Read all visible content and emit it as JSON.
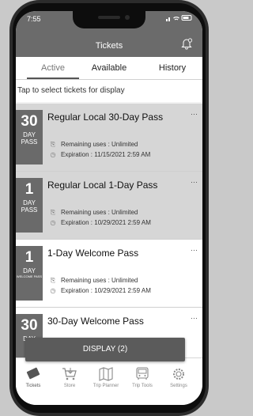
{
  "status": {
    "time": "7:55",
    "icons": "..ll ≈ ▭"
  },
  "header": {
    "title": "Tickets"
  },
  "tabs": [
    {
      "label": "Active"
    },
    {
      "label": "Available"
    },
    {
      "label": "History"
    }
  ],
  "hint": "Tap to select tickets for display",
  "tickets": [
    {
      "num": "30",
      "unit1": "DAY",
      "unit2": "PASS",
      "name": "Regular Local 30-Day Pass",
      "remaining": "Remaining uses : Unlimited",
      "expiration": "Expiration : 11/15/2021 2:59 AM",
      "more": "···"
    },
    {
      "num": "1",
      "unit1": "DAY",
      "unit2": "PASS",
      "name": "Regular Local 1-Day Pass",
      "remaining": "Remaining uses : Unlimited",
      "expiration": "Expiration : 10/29/2021 2:59 AM",
      "more": "···"
    },
    {
      "num": "1",
      "unit1": "DAY",
      "unit2": "WELCOME PASS",
      "name": "1-Day Welcome Pass",
      "remaining": "Remaining uses : Unlimited",
      "expiration": "Expiration : 10/29/2021 2:59 AM",
      "more": "···"
    },
    {
      "num": "30",
      "unit1": "DAY",
      "unit2": "",
      "name": "30-Day Welcome Pass",
      "more": "···"
    }
  ],
  "display_button": "DISPLAY (2)",
  "tabbar": [
    {
      "label": "Tickets",
      "icon": "ticket-icon"
    },
    {
      "label": "Store",
      "icon": "cart-icon"
    },
    {
      "label": "Trip Planner",
      "icon": "map-icon"
    },
    {
      "label": "Trip Tools",
      "icon": "bus-icon"
    },
    {
      "label": "Settings",
      "icon": "gear-icon"
    }
  ]
}
